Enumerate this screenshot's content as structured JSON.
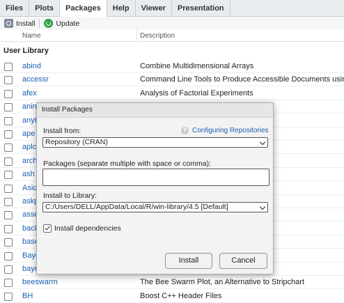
{
  "tabs": [
    {
      "label": "Files"
    },
    {
      "label": "Plots"
    },
    {
      "label": "Packages"
    },
    {
      "label": "Help"
    },
    {
      "label": "Viewer"
    },
    {
      "label": "Presentation"
    }
  ],
  "active_tab": "Packages",
  "toolbar": {
    "install_label": "Install",
    "update_label": "Update"
  },
  "columns": {
    "name": "Name",
    "description": "Description"
  },
  "section_title": "User Library",
  "packages": [
    {
      "name": "abind",
      "description": "Combine Multidimensional Arrays"
    },
    {
      "name": "accessr",
      "description": "Command Line Tools to Produce Accessible Documents using"
    },
    {
      "name": "afex",
      "description": "Analysis of Factorial Experiments"
    },
    {
      "name": "anin",
      "description": "cs"
    },
    {
      "name": "anyt",
      "description": ""
    },
    {
      "name": "ape",
      "description": ""
    },
    {
      "name": "aplc",
      "description": "mation"
    },
    {
      "name": "arch",
      "description": "Support"
    },
    {
      "name": "ash",
      "description": ""
    },
    {
      "name": "Asic",
      "description": ""
    },
    {
      "name": "askp",
      "description": "H"
    },
    {
      "name": "asse",
      "description": ""
    },
    {
      "name": "back",
      "description": "ced Since R-3.0.0"
    },
    {
      "name": "base",
      "description": ""
    },
    {
      "name": "Baye",
      "description": "on Designs"
    },
    {
      "name": "baye",
      "description": "els and Posterior Distr"
    },
    {
      "name": "beeswarm",
      "description": "The Bee Swarm Plot, an Alternative to Stripchart"
    },
    {
      "name": "BH",
      "description": "Boost C++ Header Files"
    }
  ],
  "dialog": {
    "title": "Install Packages",
    "install_from_label": "Install from:",
    "help_link": "Configuring Repositories",
    "install_from_value": "Repository (CRAN)",
    "packages_label": "Packages (separate multiple with space or comma):",
    "packages_value": "",
    "library_label": "Install to Library:",
    "library_value": "C:/Users/DELL/AppData/Local/R/win-library/4.5 [Default]",
    "dependencies_label": "Install dependencies",
    "dependencies_checked": true,
    "install_button": "Install",
    "cancel_button": "Cancel"
  }
}
